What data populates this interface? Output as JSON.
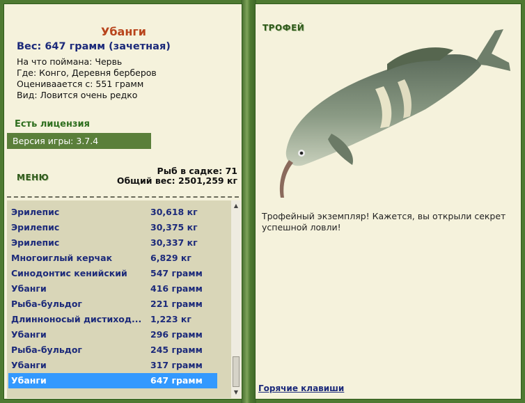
{
  "fish": {
    "name": "Убанги",
    "weight": "Вес: 647 грамм (зачетная)",
    "bait": "На что поймана: Червь",
    "location": "Где: Конго, Деревня берберов",
    "valued": "Оцениваается с: 551 грамм",
    "rarity": "Вид: Ловится очень редко"
  },
  "license": "Есть лицензия",
  "version": "Версия игры: 3.7.4",
  "menu_label": "МЕНЮ",
  "keepnet": {
    "count": "Рыб в садке: 71",
    "total": "Общий вес: 2501,259 кг"
  },
  "catch_list": [
    {
      "name": "Эрилепис",
      "weight": "30,618 кг"
    },
    {
      "name": "Эрилепис",
      "weight": "30,375 кг"
    },
    {
      "name": "Эрилепис",
      "weight": "30,337 кг"
    },
    {
      "name": "Многоиглый керчак",
      "weight": "6,829 кг"
    },
    {
      "name": "Синодонтис кенийский",
      "weight": "547 грамм"
    },
    {
      "name": "Убанги",
      "weight": "416 грамм"
    },
    {
      "name": "Рыба-бульдог",
      "weight": "221 грамм"
    },
    {
      "name": "Длинноносый дистиход...",
      "weight": "1,223 кг"
    },
    {
      "name": "Убанги",
      "weight": "296 грамм"
    },
    {
      "name": "Рыба-бульдог",
      "weight": "245 грамм"
    },
    {
      "name": "Убанги",
      "weight": "317 грамм"
    },
    {
      "name": "Убанги",
      "weight": "647 грамм"
    }
  ],
  "selected_index": 11,
  "trophy_label": "ТРОФЕЙ",
  "trophy_message": "Трофейный экземпляр! Кажется, вы открыли секрет успешной ловли!",
  "hotkeys_link": "Горячие клавиши",
  "colors": {
    "frame": "#4e7a32",
    "panel": "#f5f2dc",
    "selection": "#3399ff",
    "list_bg": "#d9d6b8"
  }
}
